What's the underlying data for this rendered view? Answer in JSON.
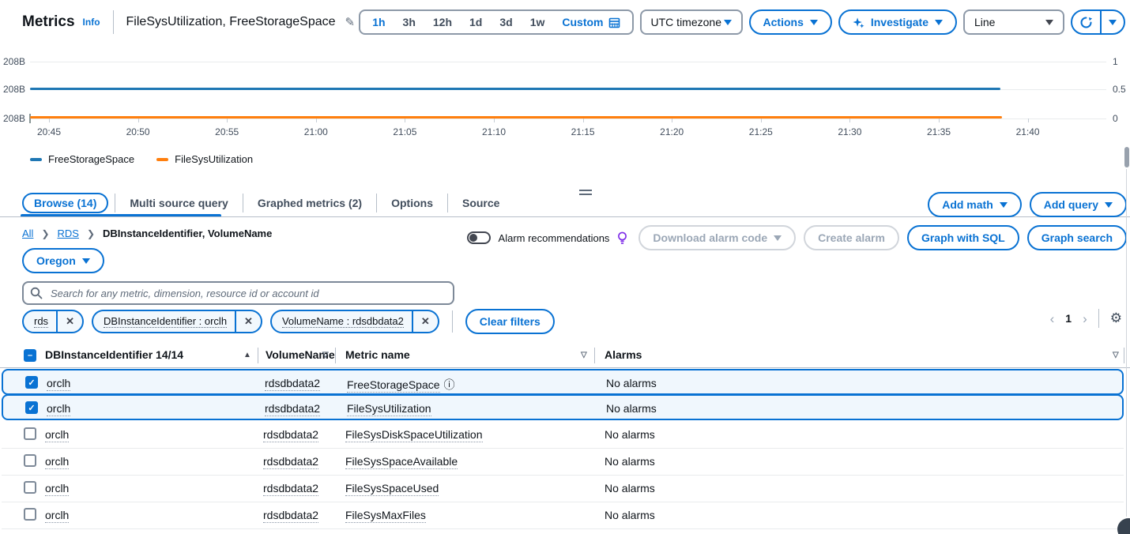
{
  "header": {
    "title": "Metrics",
    "info": "Info",
    "graph_name": "FileSysUtilization, FreeStorageSpace",
    "time_ranges": [
      "1h",
      "3h",
      "12h",
      "1d",
      "3d",
      "1w"
    ],
    "selected_time_range": "1h",
    "custom": "Custom",
    "timezone": "UTC timezone",
    "actions": "Actions",
    "investigate": "Investigate",
    "line_type": "Line"
  },
  "chart_data": {
    "type": "line",
    "title": "",
    "x_ticks": [
      "20:45",
      "20:50",
      "20:55",
      "21:00",
      "21:05",
      "21:10",
      "21:15",
      "21:20",
      "21:25",
      "21:30",
      "21:35",
      "21:40"
    ],
    "y_left_labels": [
      "208B",
      "208B",
      "208B"
    ],
    "y_right_labels": [
      "1",
      "0.5",
      "0"
    ],
    "y_right_range": [
      0,
      1
    ],
    "grid": true,
    "legend_position": "bottom",
    "series": [
      {
        "name": "FreeStorageSpace",
        "color": "#1f77b4",
        "constant_value": "208B",
        "plot_level": 0.5
      },
      {
        "name": "FileSysUtilization",
        "color": "#ff7f0e",
        "constant_value": "0",
        "plot_level": 0
      }
    ]
  },
  "panel": {
    "tabs": [
      {
        "label": "Browse (14)",
        "active": true
      },
      {
        "label": "Multi source query",
        "active": false
      },
      {
        "label": "Graphed metrics (2)",
        "active": false
      },
      {
        "label": "Options",
        "active": false
      },
      {
        "label": "Source",
        "active": false
      }
    ],
    "add_math": "Add math",
    "add_query": "Add query"
  },
  "browse": {
    "breadcrumb": {
      "all": "All",
      "rds": "RDS",
      "current": "DBInstanceIdentifier, VolumeName"
    },
    "alarm_recommendations": "Alarm recommendations",
    "download_alarm_code": "Download alarm code",
    "create_alarm": "Create alarm",
    "graph_with_sql": "Graph with SQL",
    "graph_search": "Graph search",
    "region": "Oregon",
    "search_placeholder": "Search for any metric, dimension, resource id or account id",
    "filters": [
      "rds",
      "DBInstanceIdentifier : orclh",
      "VolumeName : rdsdbdata2"
    ],
    "clear_filters": "Clear filters",
    "page": "1"
  },
  "table": {
    "columns": [
      "DBInstanceIdentifier 14/14",
      "VolumeName",
      "Metric name",
      "Alarms"
    ],
    "rows": [
      {
        "selected": true,
        "db_instance": "orclh",
        "volume": "rdsdbdata2",
        "metric": "FreeStorageSpace",
        "has_info_icon": true,
        "alarms": "No alarms"
      },
      {
        "selected": true,
        "db_instance": "orclh",
        "volume": "rdsdbdata2",
        "metric": "FileSysUtilization",
        "has_info_icon": false,
        "alarms": "No alarms"
      },
      {
        "selected": false,
        "db_instance": "orclh",
        "volume": "rdsdbdata2",
        "metric": "FileSysDiskSpaceUtilization",
        "has_info_icon": false,
        "alarms": "No alarms"
      },
      {
        "selected": false,
        "db_instance": "orclh",
        "volume": "rdsdbdata2",
        "metric": "FileSysSpaceAvailable",
        "has_info_icon": false,
        "alarms": "No alarms"
      },
      {
        "selected": false,
        "db_instance": "orclh",
        "volume": "rdsdbdata2",
        "metric": "FileSysSpaceUsed",
        "has_info_icon": false,
        "alarms": "No alarms"
      },
      {
        "selected": false,
        "db_instance": "orclh",
        "volume": "rdsdbdata2",
        "metric": "FileSysMaxFiles",
        "has_info_icon": false,
        "alarms": "No alarms"
      }
    ]
  },
  "colors": {
    "accent": "#0972d3",
    "series_blue": "#1f77b4",
    "series_orange": "#ff7f0e",
    "selected_row_bg": "#f0f7fd"
  }
}
